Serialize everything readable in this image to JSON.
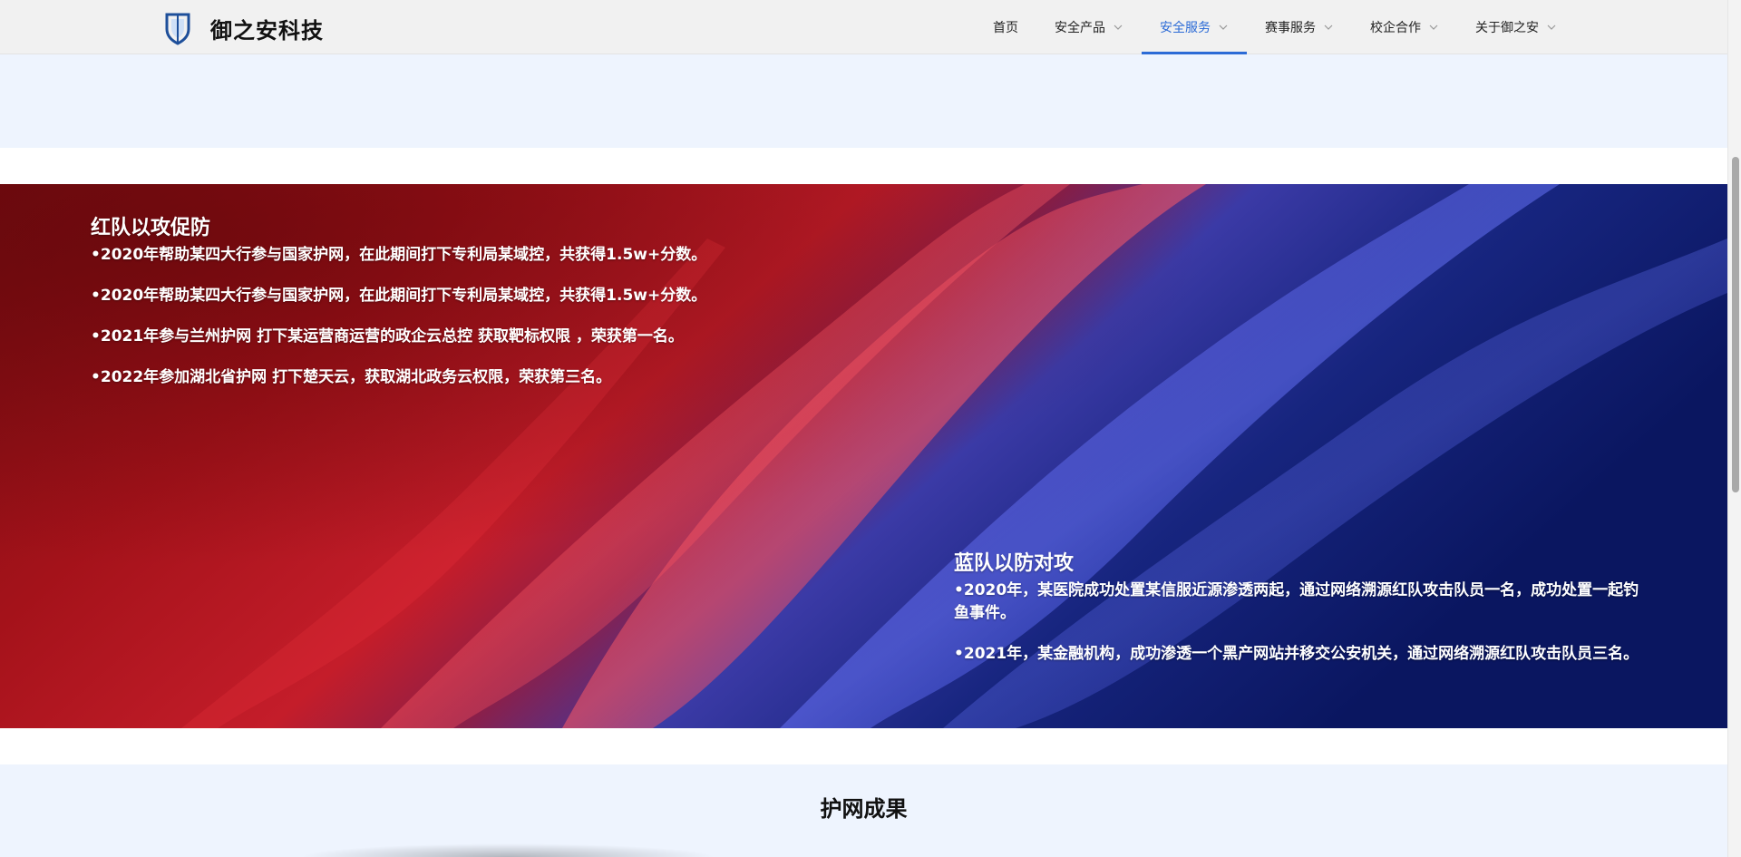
{
  "header": {
    "brand": "御之安科技",
    "logo_icon": "shield-logo-icon",
    "nav": [
      {
        "label": "首页",
        "has_dropdown": false,
        "active": false
      },
      {
        "label": "安全产品",
        "has_dropdown": true,
        "active": false
      },
      {
        "label": "安全服务",
        "has_dropdown": true,
        "active": true
      },
      {
        "label": "赛事服务",
        "has_dropdown": true,
        "active": false
      },
      {
        "label": "校企合作",
        "has_dropdown": true,
        "active": false
      },
      {
        "label": "关于御之安",
        "has_dropdown": true,
        "active": false
      }
    ]
  },
  "red_team": {
    "title": "红队以攻促防",
    "items": [
      "•2020年帮助某四大行参与国家护网，在此期间打下专利局某域控，共获得1.5w+分数。",
      "•2020年帮助某四大行参与国家护网，在此期间打下专利局某域控，共获得1.5w+分数。",
      "•2021年参与兰州护网 打下某运营商运营的政企云总控 获取靶标权限 ，荣获第一名。",
      "•2022年参加湖北省护网 打下楚天云，获取湖北政务云权限，荣获第三名。"
    ]
  },
  "blue_team": {
    "title": "蓝队以防对攻",
    "items": [
      "•2020年，某医院成功处置某信服近源渗透两起，通过网络溯源红队攻击队员一名，成功处置一起钓鱼事件。",
      "•2021年，某金融机构，成功渗透一个黑产网站并移交公安机关，通过网络溯源红队攻击队员三名。"
    ]
  },
  "results": {
    "title": "护网成果"
  },
  "colors": {
    "accent": "#2c6bd6",
    "header_bg": "#f1f1f1",
    "band_bg": "#eef4fe",
    "red": "#b5121b",
    "blue": "#0b1a6b"
  }
}
